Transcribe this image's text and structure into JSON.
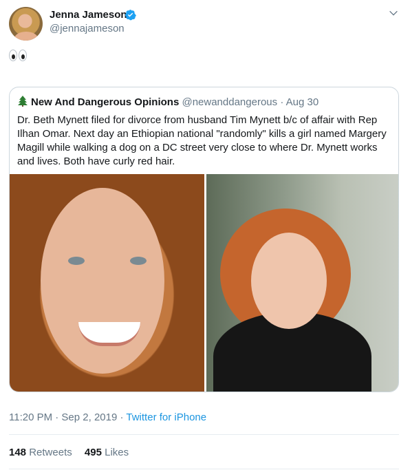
{
  "author": {
    "name": "Jenna Jameson",
    "handle": "@jennajameson",
    "avatar_icon": "profile-photo",
    "verified_icon": "verified-badge-icon",
    "verified_color": "#1da1f2"
  },
  "tweet": {
    "emoji": "👀",
    "timestamp": "11:20 PM · Sep 2, 2019",
    "separator": " · ",
    "source": "Twitter for iPhone"
  },
  "quoted": {
    "icon": "evergreen-tree-emoji",
    "name": "New And Dangerous Opinions",
    "handle": "@newanddangerous",
    "date": "· Aug 30",
    "text": "Dr. Beth Mynett filed for divorce from husband Tim Mynett b/c of affair with Rep Ilhan Omar. Next day an Ethiopian national \"randomly\" kills a girl named Margery Magill while walking a dog on a DC street very close to where Dr. Mynett works and lives. Both have curly red hair.",
    "photos": [
      "smiling woman with curly hair close-up",
      "woman with curly red hair in black shirt"
    ]
  },
  "stats": {
    "retweets_count": "148",
    "retweets_label": "Retweets",
    "likes_count": "495",
    "likes_label": "Likes"
  },
  "colors": {
    "text": "#14171a",
    "muted": "#657786",
    "link": "#1b95e0",
    "border": "#ccd6dd"
  }
}
